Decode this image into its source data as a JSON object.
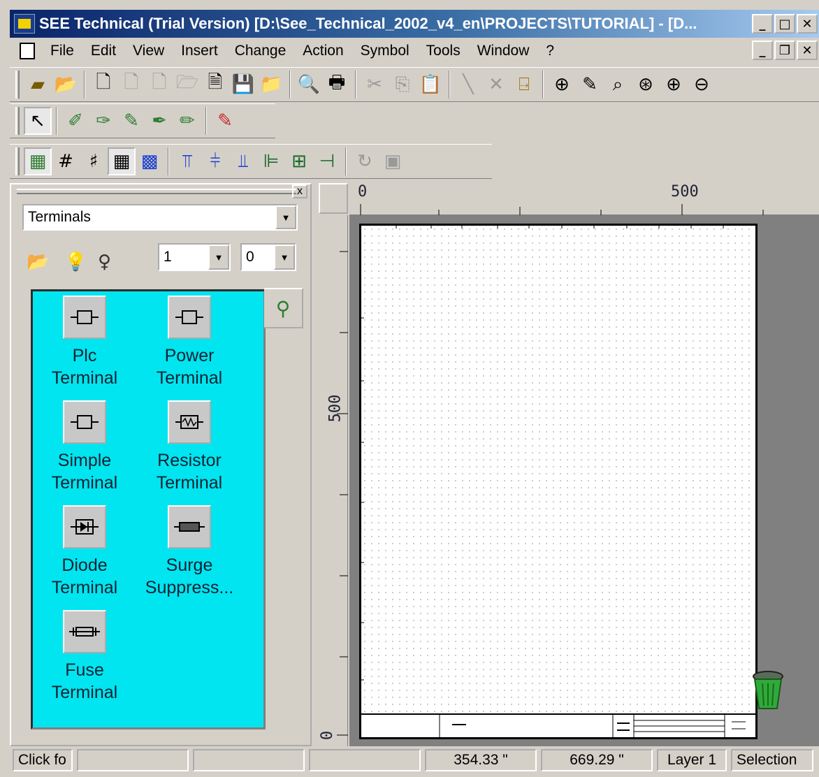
{
  "window": {
    "title": "SEE Technical (Trial Version) [D:\\See_Technical_2002_v4_en\\PROJECTS\\TUTORIAL] - [D...",
    "minimize": "_",
    "maximize": "□",
    "close": "✕",
    "restore": "❐"
  },
  "menu": [
    "File",
    "Edit",
    "View",
    "Insert",
    "Change",
    "Action",
    "Symbol",
    "Tools",
    "Window",
    "?"
  ],
  "toolbars": {
    "main_icons": [
      "new-project-icon",
      "open-folder-icon",
      "new-document-icon",
      "document-disabled-icon",
      "document-disabled-icon",
      "open-disabled-icon",
      "document-info-icon",
      "save-icon",
      "open-project-icon",
      "print-preview-icon",
      "print-icon",
      "cut-icon",
      "copy-icon",
      "paste-icon",
      "line-disabled-icon",
      "wire-disabled-icon",
      "exit-door-icon",
      "zoom-window-icon",
      "pen-icon",
      "zoom-icon",
      "zoom-all-icon",
      "zoom-in-icon",
      "zoom-out-icon"
    ],
    "draw_icons": [
      "pointer-icon",
      "wire-tool-icon",
      "wire-pen-icon",
      "label-tool-icon",
      "symbol-tool-icon",
      "link-tool-icon",
      "annotation-tool-icon"
    ],
    "grid_icons": [
      "grid-snap-icon",
      "grid-small-icon",
      "grid-medium-icon",
      "grid-large-icon",
      "grid-blue-icon",
      "align-top-icon",
      "align-center-icon",
      "align-bottom-icon",
      "align-left-icon",
      "align-middle-icon",
      "align-right-icon",
      "rotate-icon",
      "frame-icon"
    ]
  },
  "panel": {
    "close": "x",
    "category_select": "Terminals",
    "select_1": "1",
    "select_2": "0",
    "symbols": [
      {
        "label": "Plc\nTerminal",
        "icon": "plc-terminal-icon"
      },
      {
        "label": "Power\nTerminal",
        "icon": "power-terminal-icon"
      },
      {
        "label": "Simple\nTerminal",
        "icon": "simple-terminal-icon"
      },
      {
        "label": "Resistor\nTerminal",
        "icon": "resistor-terminal-icon"
      },
      {
        "label": "Diode\nTerminal",
        "icon": "diode-terminal-icon"
      },
      {
        "label": "Surge\nSuppress...",
        "icon": "surge-suppressor-icon"
      },
      {
        "label": "Fuse\nTerminal",
        "icon": "fuse-terminal-icon"
      }
    ]
  },
  "rulers": {
    "h_zero": "0",
    "h_500": "500",
    "v_500": "500",
    "v_zero": "0"
  },
  "status": {
    "hint": "Click fo",
    "x": "354.33 \"",
    "y": "669.29 \"",
    "layer": "Layer 1",
    "mode": "Selection"
  }
}
